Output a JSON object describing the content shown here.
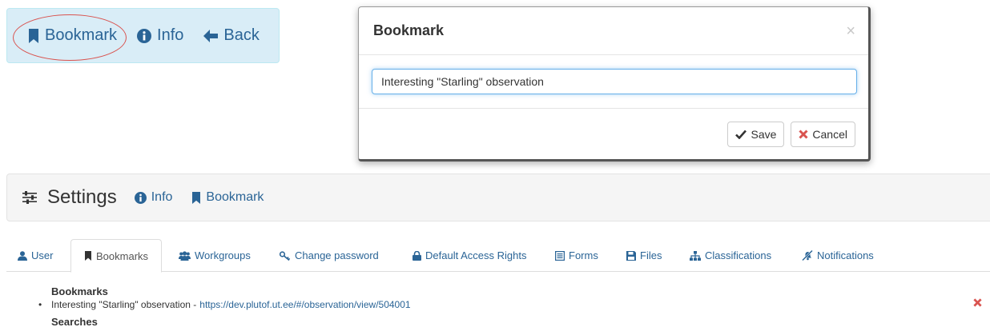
{
  "toolbar": {
    "bookmark_label": "Bookmark",
    "info_label": "Info",
    "back_label": "Back"
  },
  "modal": {
    "title": "Bookmark",
    "close_symbol": "×",
    "input_value": "Interesting \"Starling\" observation",
    "save_label": "Save",
    "cancel_label": "Cancel"
  },
  "settings": {
    "title": "Settings",
    "info_label": "Info",
    "bookmark_label": "Bookmark"
  },
  "tabs": [
    {
      "label": "User",
      "icon": "user-icon"
    },
    {
      "label": "Bookmarks",
      "icon": "bookmark-icon",
      "active": true
    },
    {
      "label": "Workgroups",
      "icon": "group-icon"
    },
    {
      "label": "Change password",
      "icon": "key-icon"
    },
    {
      "label": "Default Access Rights",
      "icon": "lock-icon"
    },
    {
      "label": "Forms",
      "icon": "list-icon"
    },
    {
      "label": "Files",
      "icon": "save-icon"
    },
    {
      "label": "Classifications",
      "icon": "sitemap-icon"
    },
    {
      "label": "Notifications",
      "icon": "bell-slash-icon"
    }
  ],
  "content": {
    "bookmarks_heading": "Bookmarks",
    "bookmark_item": {
      "text": "Interesting \"Starling\" observation -",
      "link": "https://dev.plutof.ut.ee/#/observation/view/504001"
    },
    "searches_heading": "Searches"
  },
  "colors": {
    "link": "#2a6496",
    "toolbar_bg": "#d9edf7",
    "danger": "#d9534f"
  }
}
